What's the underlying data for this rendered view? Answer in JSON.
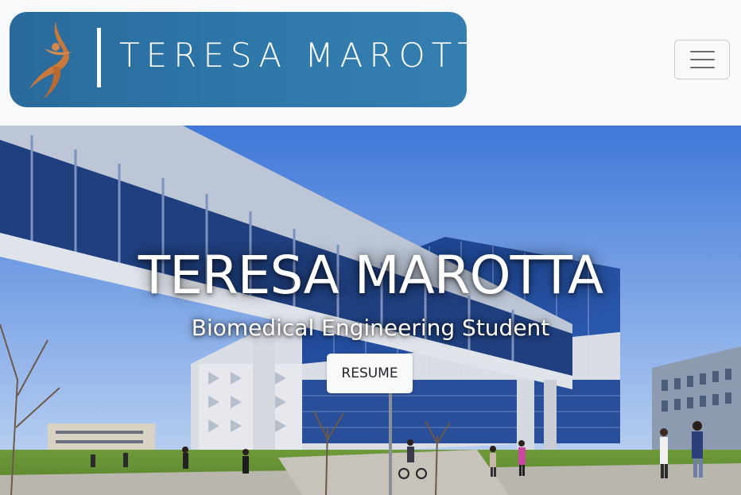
{
  "navbar": {
    "logo_text": "TERESA MAROTTA",
    "logo_colors": {
      "background": "#2e78aa",
      "figure": "#c8783a",
      "text": "#ffffff"
    },
    "toggler_icon": "hamburger-menu-icon"
  },
  "hero": {
    "title": "TERESA MAROTTA",
    "subtitle": "Biomedical Engineering Student",
    "resume_label": "RESUME",
    "background_image": "campus-building-skybridge-photo"
  }
}
